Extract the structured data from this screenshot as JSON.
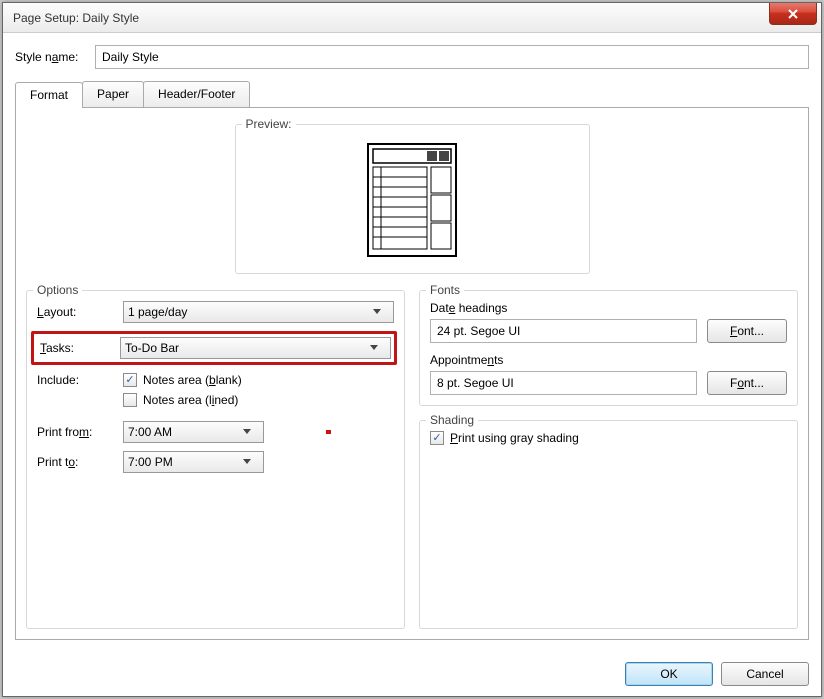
{
  "window": {
    "title": "Page Setup: Daily Style"
  },
  "style": {
    "label_prefix": "Style n",
    "label_u": "a",
    "label_suffix": "me:",
    "value": "Daily Style"
  },
  "tabs": [
    {
      "label": "Format",
      "active": true
    },
    {
      "label": "Paper",
      "active": false
    },
    {
      "label": "Header/Footer",
      "active": false
    }
  ],
  "preview": {
    "title": "Preview:"
  },
  "options": {
    "title": "Options",
    "layout": {
      "label_prefix": "",
      "label_u": "L",
      "label_suffix": "ayout:",
      "value": "1 page/day"
    },
    "tasks": {
      "label_prefix": "",
      "label_u": "T",
      "label_suffix": "asks:",
      "value": "To-Do Bar"
    },
    "include": {
      "label": "Include:"
    },
    "notes_blank": {
      "checked": true,
      "prefix": "Notes area (",
      "u": "b",
      "suffix": "lank)"
    },
    "notes_lined": {
      "checked": false,
      "prefix": "Notes area (l",
      "u": "i",
      "suffix": "ned)"
    },
    "print_from": {
      "label_prefix": "Print fro",
      "label_u": "m",
      "label_suffix": ":",
      "value": "7:00 AM"
    },
    "print_to": {
      "label_prefix": "Print t",
      "label_u": "o",
      "label_suffix": ":",
      "value": "7:00 PM"
    }
  },
  "fonts": {
    "title": "Fonts",
    "date_headings": {
      "label_prefix": "Dat",
      "label_u": "e",
      "label_suffix": " headings",
      "value": "24 pt. Segoe UI",
      "button_prefix": "",
      "button_u": "F",
      "button_suffix": "ont..."
    },
    "appointments": {
      "label_prefix": "Appointme",
      "label_u": "n",
      "label_suffix": "ts",
      "value": "8 pt. Segoe UI",
      "button_prefix": "F",
      "button_u": "o",
      "button_suffix": "nt..."
    }
  },
  "shading": {
    "title": "Shading",
    "print_gray": {
      "checked": true,
      "prefix": "",
      "u": "P",
      "suffix": "rint using gray shading"
    }
  },
  "footer": {
    "ok": "OK",
    "cancel": "Cancel"
  }
}
